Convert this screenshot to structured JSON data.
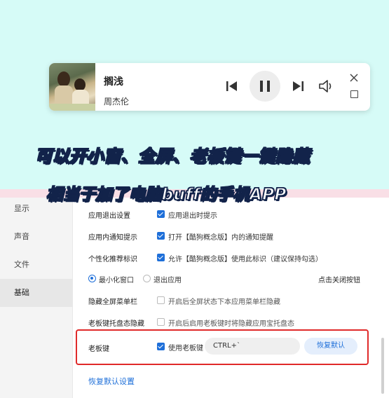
{
  "player": {
    "song_title": "搁浅",
    "artist": "周杰伦",
    "icons": [
      "prev-icon",
      "pause-icon",
      "next-icon",
      "volume-icon",
      "close-icon",
      "maximize-icon"
    ]
  },
  "captions": {
    "line1": "可以开小窗、全屏、老板键一键隐藏",
    "line2": "相当于加了电脑buff的手机APP"
  },
  "sidebar": {
    "items": [
      {
        "label": "显示"
      },
      {
        "label": "声音"
      },
      {
        "label": "文件"
      },
      {
        "label": "基础",
        "active": true
      }
    ]
  },
  "settings": {
    "exit": {
      "label": "应用退出设置",
      "option": "应用退出时提示",
      "checked": true
    },
    "notify": {
      "label": "应用内通知提示",
      "option": "打开【酷狗概念版】内的通知提醒",
      "checked": true
    },
    "personal": {
      "label": "个性化推荐标识",
      "option": "允许【酷狗概念版】使用此标识（建议保持勾选）",
      "checked": true
    },
    "close_action": {
      "options": [
        "最小化窗口",
        "退出应用"
      ],
      "selected": "最小化窗口",
      "right_label": "点击关闭按钮"
    },
    "hide_menu": {
      "label": "隐藏全屏菜单栏",
      "option": "开启后全屏状态下本应用菜单栏隐藏",
      "checked": false
    },
    "boss_tray": {
      "label": "老板键托盘态隐藏",
      "option": "开启后启用老板键时将隐藏应用宝托盘态",
      "checked": false
    },
    "boss_key": {
      "label": "老板键",
      "option": "使用老板键",
      "checked": true,
      "hotkey": "CTRL+`",
      "restore_label": "恢复默认"
    },
    "restore_all_label": "恢复默认设置"
  },
  "colors": {
    "accent": "#1e6fd9",
    "highlight": "#e02a2a",
    "top_bg": "#d6fbf7"
  }
}
